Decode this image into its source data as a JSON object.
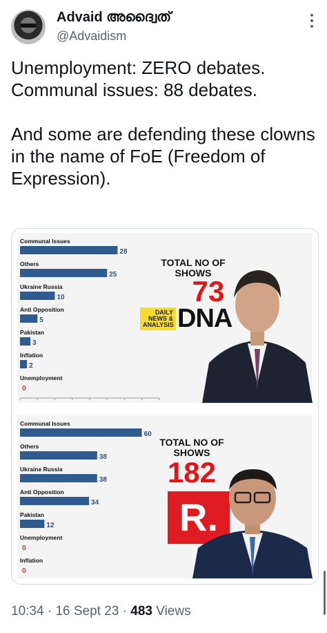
{
  "author": {
    "display_name": "Advaid അദ്വൈത്",
    "handle": "@Advaidism"
  },
  "tweet": {
    "text": "Unemployment: ZERO debates.\nCommunal issues: 88 debates.\n\nAnd some are defending these clowns in the name of FoE (Freedom of Expression)."
  },
  "media": {
    "top": {
      "total_label": "TOTAL NO OF SHOWS",
      "total_value": "73",
      "logo_box_text": "DAILY NEWS & ANALYSIS",
      "logo_text": "DNA"
    },
    "bottom": {
      "total_label": "TOTAL NO OF SHOWS",
      "total_value": "182",
      "logo_text": "R."
    }
  },
  "chart_data": [
    {
      "type": "bar",
      "categories": [
        "Communal Issues",
        "Others",
        "Ukraine Russia",
        "Anti Opposition",
        "Pakistan",
        "Inflation",
        "Unemployment"
      ],
      "values": [
        28,
        25,
        10,
        5,
        3,
        2,
        0
      ],
      "xlim": [
        0,
        40
      ],
      "color": "#2f5b8f"
    },
    {
      "type": "bar",
      "categories": [
        "Communal Issues",
        "Others",
        "Ukraine Russia",
        "Anti Opposition",
        "Pakistan",
        "Unemployment",
        "Inflation"
      ],
      "values": [
        60,
        38,
        38,
        34,
        12,
        0,
        0
      ],
      "xlim": [
        0,
        70
      ],
      "color": "#2f5b8f"
    }
  ],
  "footer": {
    "time": "10:34",
    "date": "16 Sept 23",
    "views": "483",
    "views_label": "Views",
    "sep": "·"
  },
  "colors": {
    "accent_red": "#e0161b",
    "bar_blue": "#2f5b8f",
    "muted": "#536471"
  }
}
